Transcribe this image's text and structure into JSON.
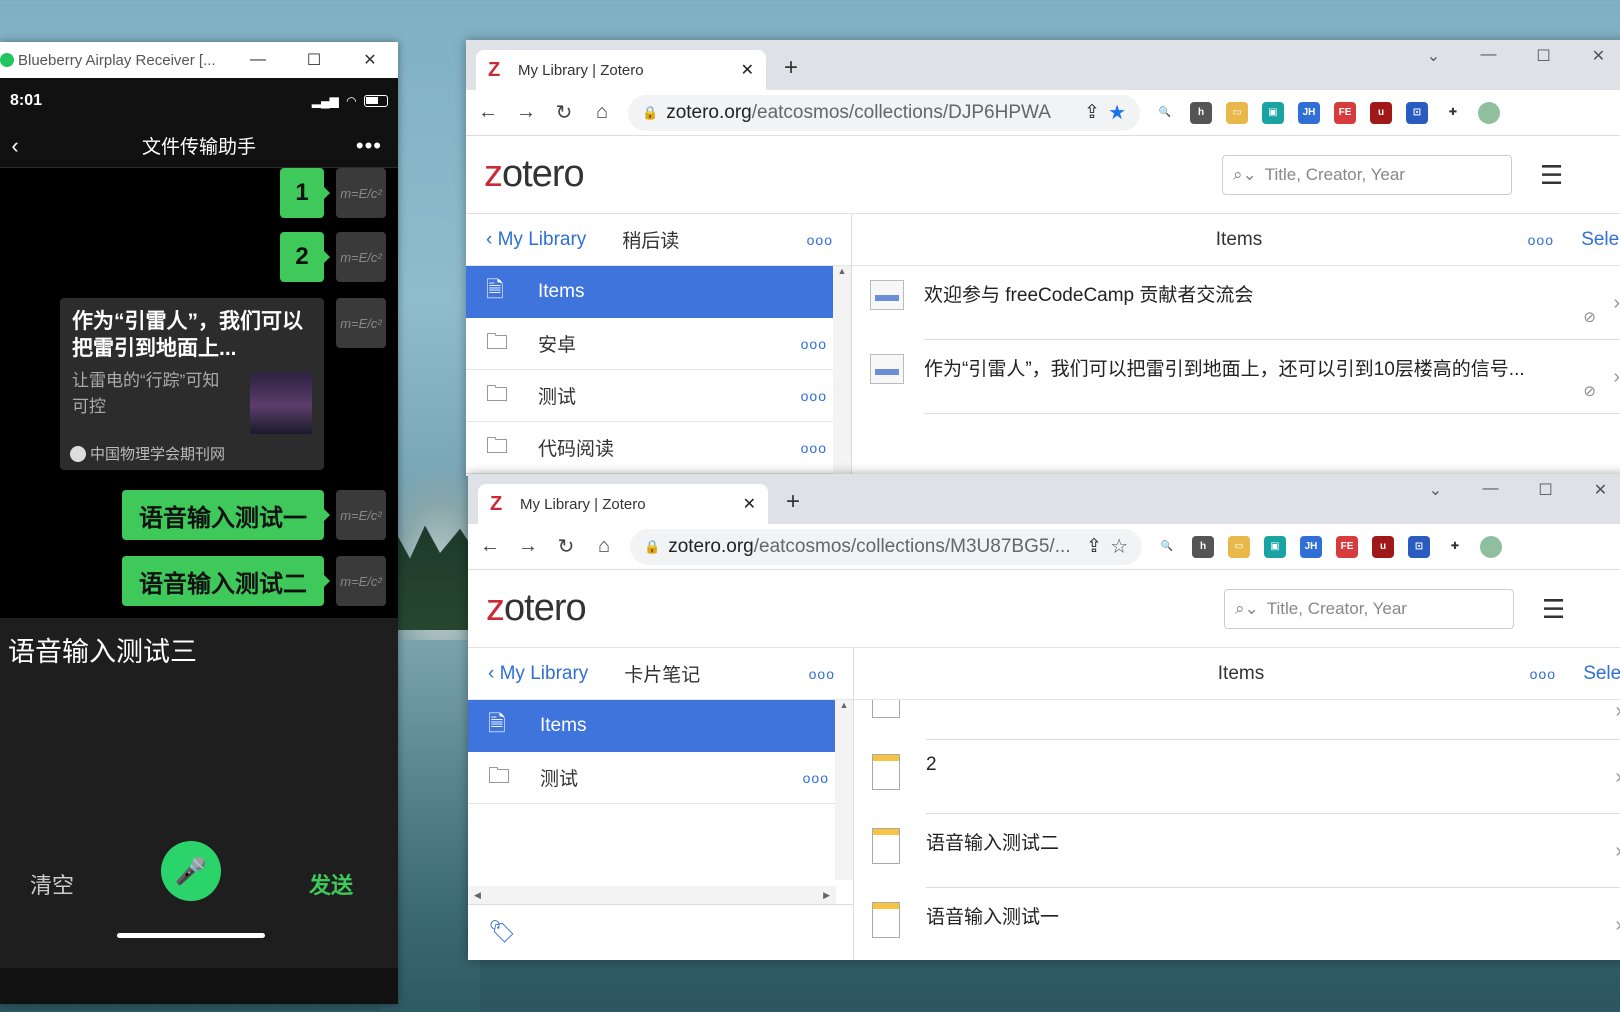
{
  "phone": {
    "window_title": "Blueberry Airplay Receiver [...",
    "status_time": "8:01",
    "chat_title": "文件传输助手",
    "messages": [
      "1",
      "2"
    ],
    "card": {
      "title": "作为“引雷人”，我们可以把雷引到地面上...",
      "desc": "让雷电的“行踪”可知可控",
      "source": "中国物理学会期刊网"
    },
    "voice_msgs": [
      "语音输入测试一",
      "语音输入测试二"
    ],
    "input_text": "语音输入测试三",
    "clear_label": "清空",
    "send_label": "发送",
    "avatar_text": "m=E/c²"
  },
  "browser1": {
    "tab_title": "My Library | Zotero",
    "url_host": "zotero.org",
    "url_path": "/eatcosmos/collections/DJP6HPWA",
    "search_placeholder": "Title, Creator, Year",
    "back_label": "My Library",
    "collection": "稍后读",
    "items_header": "Items",
    "select_label": "Select",
    "sidebar": [
      {
        "label": "Items",
        "active": true
      },
      {
        "label": "安卓"
      },
      {
        "label": "测试"
      },
      {
        "label": "代码阅读"
      }
    ],
    "items": [
      "欢迎参与 freeCodeCamp 贡献者交流会",
      "作为“引雷人”，我们可以把雷引到地面上，还可以引到10层楼高的信号..."
    ]
  },
  "browser2": {
    "tab_title": "My Library | Zotero",
    "url_host": "zotero.org",
    "url_path": "/eatcosmos/collections/M3U87BG5/...",
    "search_placeholder": "Title, Creator, Year",
    "back_label": "My Library",
    "collection": "卡片笔记",
    "items_header": "Items",
    "select_label": "Select",
    "sidebar": [
      {
        "label": "Items",
        "active": true
      },
      {
        "label": "测试"
      }
    ],
    "items": [
      "",
      "2",
      "语音输入测试二",
      "语音输入测试一"
    ]
  },
  "common": {
    "logo_z": "z",
    "logo_rest": "otero",
    "dots": "ooo",
    "tab_favicon": "Z"
  },
  "colors": {
    "accent": "#3f74dd",
    "link": "#2f6fd6",
    "wechat_green": "#3ec95a",
    "zotero_red": "#cc2936"
  }
}
